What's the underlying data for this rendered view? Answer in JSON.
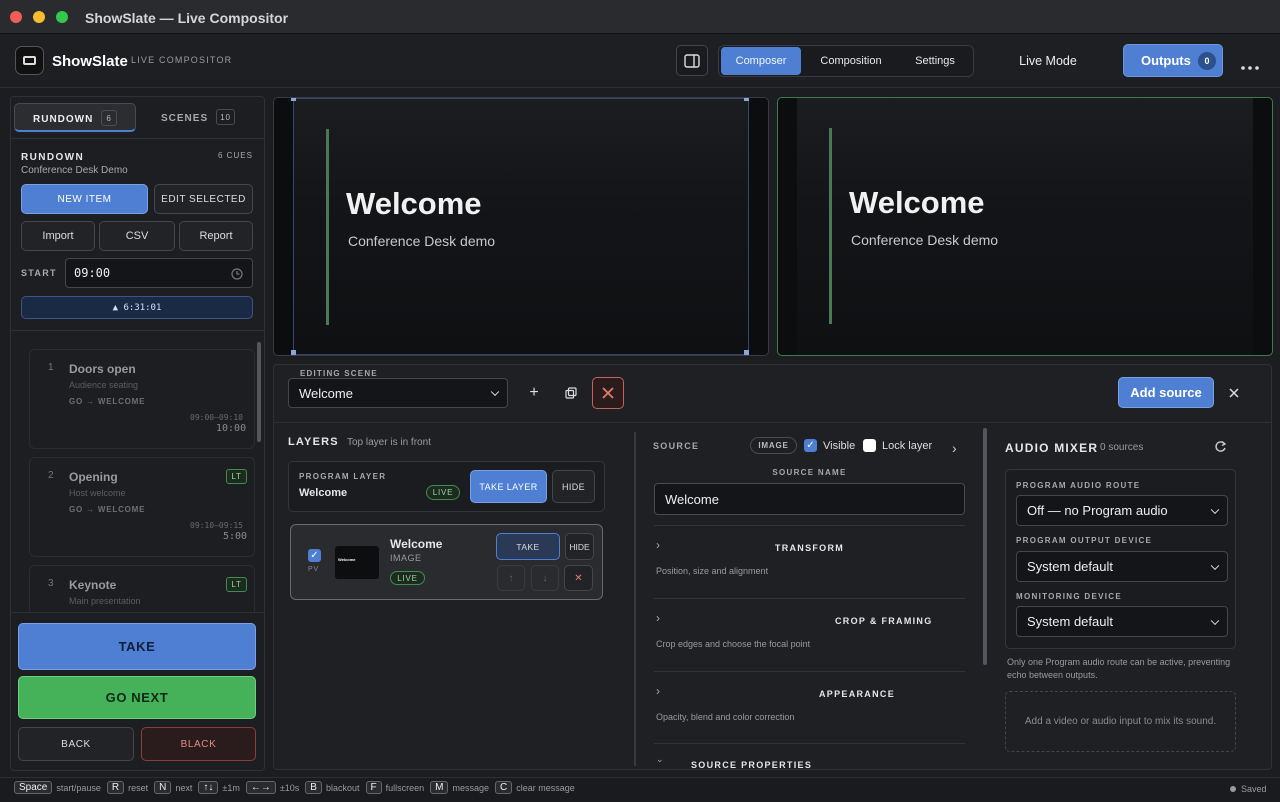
{
  "window": {
    "title": "ShowSlate — Live Compositor"
  },
  "brand": {
    "name": "ShowSlate",
    "subtitle": "LIVE COMPOSITOR"
  },
  "topbar": {
    "tabs": [
      "Composer",
      "Composition",
      "Settings"
    ],
    "live_mode": "Live Mode",
    "outputs_label": "Outputs",
    "outputs_count": "0"
  },
  "left": {
    "tab_rundown": "RUNDOWN",
    "tab_rundown_count": "6",
    "tab_scenes": "SCENES",
    "tab_scenes_count": "10",
    "heading": "RUNDOWN",
    "cue_count": "6 CUES",
    "show_name": "Conference Desk Demo",
    "new_item": "NEW ITEM",
    "edit_selected": "EDIT SELECTED",
    "import": "Import",
    "csv": "CSV",
    "report": "Report",
    "start_label": "START",
    "start_value": "09:00",
    "duration": "▲ 6:31:01",
    "cues": [
      {
        "num": "1",
        "title": "Doors open",
        "sub": "Audience seating",
        "go": "GO → WELCOME",
        "range": "09:00–09:10",
        "dur": "10:00",
        "badge": ""
      },
      {
        "num": "2",
        "title": "Opening",
        "sub": "Host welcome",
        "go": "GO → WELCOME",
        "range": "09:10–09:15",
        "dur": "5:00",
        "badge": "LT"
      },
      {
        "num": "3",
        "title": "Keynote",
        "sub": "Main presentation",
        "go": "",
        "range": "",
        "dur": "",
        "badge": "LT"
      }
    ],
    "take": "TAKE",
    "go_next": "GO NEXT",
    "back": "BACK",
    "black": "BLACK"
  },
  "preview": {
    "title": "Welcome",
    "subtitle": "Conference Desk demo"
  },
  "program": {
    "title": "Welcome",
    "subtitle": "Conference Desk demo"
  },
  "editor": {
    "scene_label": "EDITING SCENE",
    "scene_value": "Welcome",
    "add_source": "Add source"
  },
  "layers": {
    "heading": "LAYERS",
    "hint": "Top layer is in front",
    "program_layer_label": "PROGRAM LAYER",
    "program_layer_name": "Welcome",
    "live": "LIVE",
    "take_layer": "TAKE LAYER",
    "hide": "HIDE",
    "item": {
      "pv": "PV",
      "name": "Welcome",
      "type": "IMAGE",
      "live": "LIVE",
      "take": "TAKE",
      "hide": "HIDE",
      "thumb_text": "Welcome"
    }
  },
  "source": {
    "heading": "SOURCE",
    "type_badge": "IMAGE",
    "visible": "Visible",
    "lock": "Lock layer",
    "name_label": "SOURCE NAME",
    "name_value": "Welcome",
    "sections": [
      {
        "title": "TRANSFORM",
        "desc": "Position, size and alignment"
      },
      {
        "title": "CROP & FRAMING",
        "desc": "Crop edges and choose the focal point"
      },
      {
        "title": "APPEARANCE",
        "desc": "Opacity, blend and color correction"
      },
      {
        "title": "SOURCE PROPERTIES",
        "desc": ""
      }
    ]
  },
  "audio": {
    "heading": "AUDIO MIXER",
    "count": "0 sources",
    "route_label": "PROGRAM AUDIO ROUTE",
    "route_value": "Off — no Program audio",
    "output_label": "PROGRAM OUTPUT DEVICE",
    "output_value": "System default",
    "monitor_label": "MONITORING DEVICE",
    "monitor_value": "System default",
    "note": "Only one Program audio route can be active, preventing echo between outputs.",
    "empty": "Add a video or audio input to mix its sound."
  },
  "statusbar": {
    "shortcuts": [
      {
        "key": "Space",
        "desc": "start/pause"
      },
      {
        "key": "R",
        "desc": "reset"
      },
      {
        "key": "N",
        "desc": "next"
      },
      {
        "key": "↑↓",
        "desc": "±1m"
      },
      {
        "key": "←→",
        "desc": "±10s"
      },
      {
        "key": "B",
        "desc": "blackout"
      },
      {
        "key": "F",
        "desc": "fullscreen"
      },
      {
        "key": "M",
        "desc": "message"
      },
      {
        "key": "C",
        "desc": "clear message"
      }
    ],
    "saved": "Saved"
  },
  "colors": {
    "accent": "#4f7fd3",
    "go_green": "#45b25a",
    "danger": "#c9605a",
    "live_green": "#3e8e4b"
  }
}
